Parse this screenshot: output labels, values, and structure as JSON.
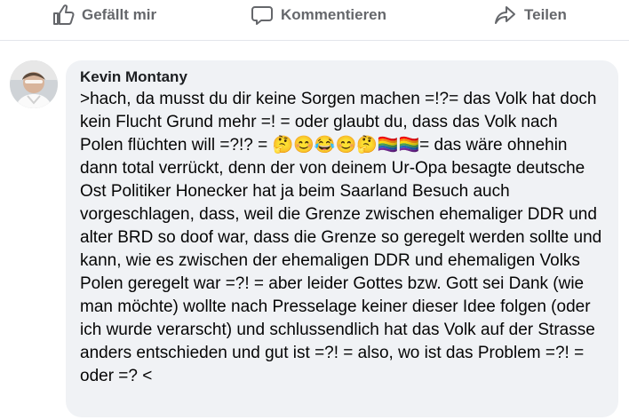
{
  "actions": {
    "like_label": "Gefällt mir",
    "comment_label": "Kommentieren",
    "share_label": "Teilen",
    "like_icon": "thumbs-up-icon",
    "comment_icon": "speech-bubble-icon",
    "share_icon": "share-arrow-icon"
  },
  "comment": {
    "author": "Kevin Montany",
    "text": ">hach, da musst du dir keine Sorgen machen =!?= das Volk hat doch kein Flucht Grund mehr =! = oder glaubt du, dass das Volk nach Polen flüchten will =?!? = 🤔😊😂😊🤔🏳️‍🌈🏳️‍🌈= das wäre ohnehin dann total verrückt, denn der von deinem Ur-Opa besagte deutsche Ost Politiker Honecker hat ja beim Saarland Besuch auch vorgeschlagen, dass, weil die Grenze zwischen ehemaliger DDR und alter BRD so doof war, dass die Grenze so geregelt werden sollte und kann, wie es zwischen der ehemaligen DDR und ehemaligen Volks Polen geregelt war =?! = aber leider Gottes bzw. Gott sei Dank (wie man möchte) wollte nach Presselage keiner dieser Idee folgen (oder ich wurde verarscht) und schlussendlich hat das Volk auf der Strasse anders entschieden und gut ist =?! = also, wo ist das Problem =?! = oder =? <"
  },
  "colors": {
    "action_text": "#65676b",
    "bubble_background": "#f0f2f5",
    "author_text": "#1c1e21",
    "comment_text": "#050505",
    "divider": "#e4e6eb"
  }
}
